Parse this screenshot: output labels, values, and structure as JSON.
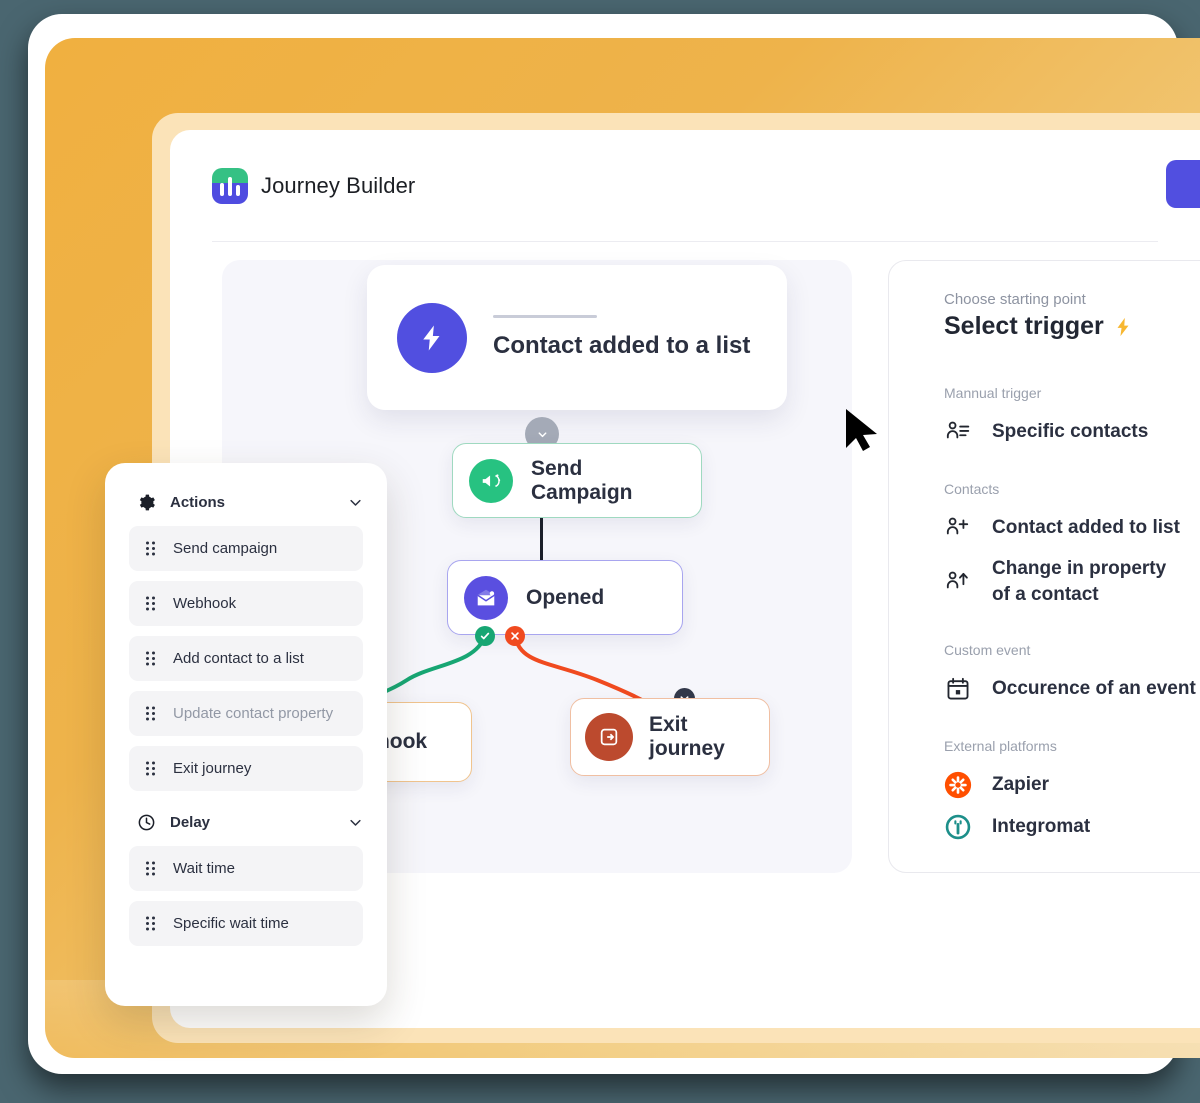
{
  "app": {
    "title": "Journey Builder",
    "logo_icon": "journey-builder-logo",
    "cta_icon": "primary-action-button"
  },
  "canvas": {
    "trigger_node": {
      "label": "Contact added to a list",
      "icon": "lightning-bolt-icon",
      "icon_color": "#514fe0"
    },
    "nodes": [
      {
        "label": "Send Campaign",
        "icon": "megaphone-icon",
        "icon_color": "#27c281",
        "border_color": "#9fd9c0"
      },
      {
        "label": "Opened",
        "icon": "envelope-open-icon",
        "icon_color": "#5a4fe0",
        "border_color": "#a8a5ef"
      },
      {
        "label": "Webhook",
        "icon": "webhook-icon",
        "icon_color": "#d2693f",
        "border_color": "#f0c48e"
      },
      {
        "label": "Exit journey",
        "icon": "exit-door-icon",
        "icon_color": "#bc4a2e",
        "border_color": "#f0bfa2"
      }
    ],
    "branch_yes_icon": "check-circle-icon",
    "branch_no_icon": "x-circle-icon",
    "branch_yes_color": "#17a673",
    "branch_no_color": "#f04a1f",
    "cursor_icon": "mouse-cursor-arrow"
  },
  "trigger_panel": {
    "kicker": "Choose starting point",
    "title": "Select trigger",
    "title_icon": "lightning-emoji",
    "groups": [
      {
        "label": "Mannual trigger",
        "items": [
          {
            "label": "Specific contacts",
            "icon": "person-list-icon"
          }
        ]
      },
      {
        "label": "Contacts",
        "items": [
          {
            "label": "Contact added to list",
            "icon": "person-plus-icon"
          },
          {
            "label": "Change in property of a contact",
            "icon": "person-arrow-up-icon"
          }
        ]
      },
      {
        "label": "Custom event",
        "items": [
          {
            "label": "Occurence of an event",
            "icon": "calendar-icon"
          }
        ]
      },
      {
        "label": "External platforms",
        "items": [
          {
            "label": "Zapier",
            "icon": "zapier-icon",
            "icon_color": "#ff4f00"
          },
          {
            "label": "Integromat",
            "icon": "integromat-icon",
            "icon_color": "#1d8f8a"
          }
        ]
      }
    ]
  },
  "actions_panel": {
    "sections": [
      {
        "title": "Actions",
        "icon": "gear-icon",
        "chevron": "chevron-down-icon",
        "items": [
          {
            "label": "Send campaign",
            "muted": false
          },
          {
            "label": "Webhook",
            "muted": false
          },
          {
            "label": "Add contact to a list",
            "muted": false
          },
          {
            "label": "Update contact property",
            "muted": true
          },
          {
            "label": "Exit journey",
            "muted": false
          }
        ]
      },
      {
        "title": "Delay",
        "icon": "clock-icon",
        "chevron": "chevron-down-icon",
        "items": [
          {
            "label": "Wait time",
            "muted": false
          },
          {
            "label": "Specific wait time",
            "muted": false
          }
        ]
      }
    ],
    "drag_handle_icon": "drag-grip-icon"
  },
  "colors": {
    "background": "#4a6670",
    "amber": "#f0b040",
    "amber_light": "#fbe3b8",
    "canvas": "#f6f6fb",
    "accent_purple": "#514fe0"
  }
}
